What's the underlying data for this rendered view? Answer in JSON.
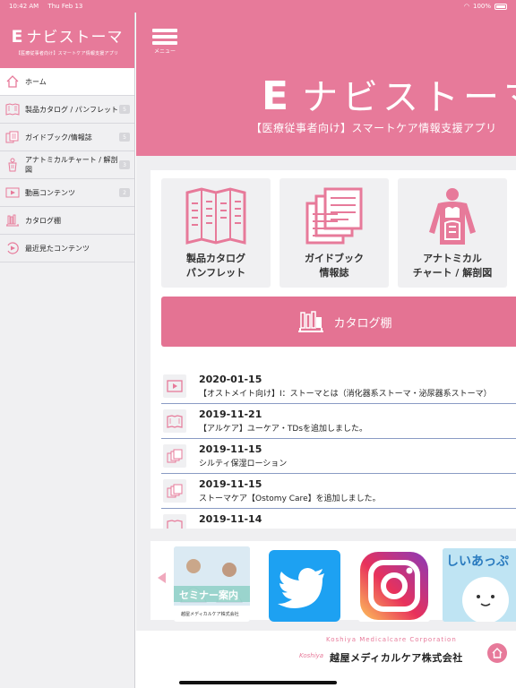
{
  "status": {
    "time": "10:42 AM",
    "date": "Thu Feb 13",
    "battery": "100%"
  },
  "sidebar": {
    "logo_letter": "E",
    "logo_text": "ナビストーマ",
    "subtitle": "【医療従事者向け】スマートケア情報支援アプリ",
    "items": [
      {
        "label": "ホーム",
        "icon": "home-icon",
        "badge": ""
      },
      {
        "label": "製品カタログ / パンフレット",
        "icon": "catalog-icon",
        "badge": "5"
      },
      {
        "label": "ガイドブック/情報誌",
        "icon": "guidebook-icon",
        "badge": "5"
      },
      {
        "label": "アナトミカルチャート / 解剖図",
        "icon": "anatomy-icon",
        "badge": "3"
      },
      {
        "label": "動画コンテンツ",
        "icon": "video-icon",
        "badge": "2"
      },
      {
        "label": "カタログ棚",
        "icon": "bookshelf-icon",
        "badge": ""
      },
      {
        "label": "最近見たコンテンツ",
        "icon": "history-icon",
        "badge": ""
      }
    ]
  },
  "banner": {
    "menu_label": "メニュー",
    "title_letter": "E",
    "title_text": "ナビストーマ",
    "subtitle": "【医療従事者向け】スマートケア情報支援アプリ"
  },
  "tiles": [
    {
      "line1": "製品カタログ",
      "line2": "パンフレット"
    },
    {
      "line1": "ガイドブック",
      "line2": "情報誌"
    },
    {
      "line1": "アナトミカル",
      "line2": "チャート / 解剖図"
    }
  ],
  "catalog_button": "カタログ棚",
  "news": [
    {
      "date": "2020-01-15",
      "text": "【オストメイト向け】Ⅰ：ストーマとは（消化器系ストーマ・泌尿器系ストーマ）",
      "icon": "video-icon"
    },
    {
      "date": "2019-11-21",
      "text": "【アルケア】ユーケア・TDsを追加しました。",
      "icon": "catalog-icon"
    },
    {
      "date": "2019-11-15",
      "text": "シルティ保湿ローション",
      "icon": "guidebook-icon"
    },
    {
      "date": "2019-11-15",
      "text": "ストーマケア【Ostomy Care】を追加しました。",
      "icon": "guidebook-icon"
    },
    {
      "date": "2019-11-14",
      "text": "",
      "icon": "catalog-icon"
    }
  ],
  "carousel": {
    "seminar_label": "セミナー案内",
    "seminar_caption": "越屋メディカルケア株式会社",
    "twitter": "twitter-icon",
    "instagram": "instagram-icon",
    "mascot_text": "しいあっぷ"
  },
  "footer": {
    "corp_en": "Koshiya Medicalcare Corporation",
    "corp_sig": "Koshiya",
    "corp_jp": "越屋メディカルケア株式会社"
  },
  "colors": {
    "brand_pink": "#e77a9a",
    "catalog_pink": "#e47393",
    "twitter_blue": "#1da1f2"
  }
}
